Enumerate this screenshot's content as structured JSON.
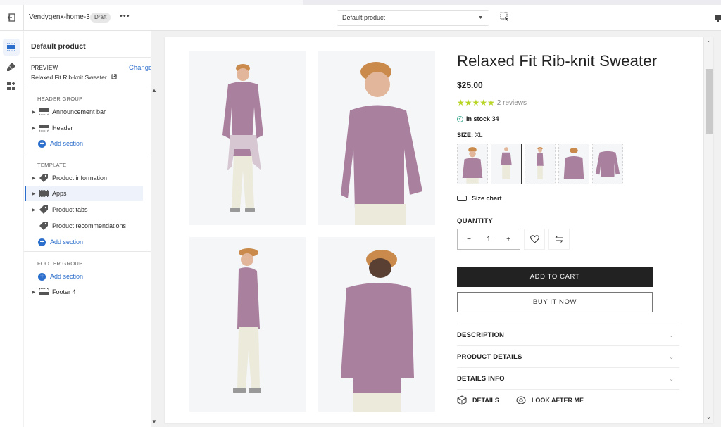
{
  "topbar": {
    "theme_name": "Vendygenx-home-3",
    "status_badge": "Draft",
    "more_label": "•••",
    "template_select": {
      "selected": "Default product"
    }
  },
  "sidebar": {
    "title": "Default product",
    "preview": {
      "label": "PREVIEW",
      "change_label": "Change",
      "product": "Relaxed Fit Rib-knit Sweater"
    },
    "groups": [
      {
        "label": "HEADER GROUP",
        "items": [
          {
            "label": "Announcement bar",
            "icon": "section-top-icon",
            "expandable": true
          },
          {
            "label": "Header",
            "icon": "section-top-icon",
            "expandable": true
          }
        ],
        "add_section_label": "Add section"
      },
      {
        "label": "TEMPLATE",
        "items": [
          {
            "label": "Product information",
            "icon": "tag-icon",
            "expandable": true
          },
          {
            "label": "Apps",
            "icon": "section-icon",
            "expandable": true,
            "selected": true
          },
          {
            "label": "Product tabs",
            "icon": "tag-icon",
            "expandable": true
          },
          {
            "label": "Product recommendations",
            "icon": "tag-icon",
            "expandable": false
          }
        ],
        "add_section_label": "Add section"
      },
      {
        "label": "FOOTER GROUP",
        "add_section_label": "Add section",
        "items": [
          {
            "label": "Footer 4",
            "icon": "section-bottom-icon",
            "expandable": true
          }
        ]
      }
    ]
  },
  "product": {
    "title": "Relaxed Fit Rib-knit Sweater",
    "price": "$25.00",
    "rating": {
      "stars": 5,
      "max": 5,
      "reviews_label": "2 reviews"
    },
    "stock_label": "In stock 34",
    "size": {
      "label": "SIZE:",
      "value": "XL"
    },
    "swatch_count": 5,
    "selected_swatch": 2,
    "size_chart_label": "Size chart",
    "quantity": {
      "label": "QUANTITY",
      "value": "1",
      "minus": "−",
      "plus": "+"
    },
    "add_to_cart": "ADD TO CART",
    "buy_now": "BUY IT NOW",
    "accordions": [
      "DESCRIPTION",
      "PRODUCT DETAILS",
      "DETAILS INFO"
    ],
    "extra_links": [
      "DETAILS",
      "LOOK AFTER ME"
    ]
  },
  "colors": {
    "accent": "#2c6ecb",
    "star": "#b8d424",
    "sweater": "#a9809e",
    "cap": "#c98a4b",
    "pants": "#eceadb"
  }
}
